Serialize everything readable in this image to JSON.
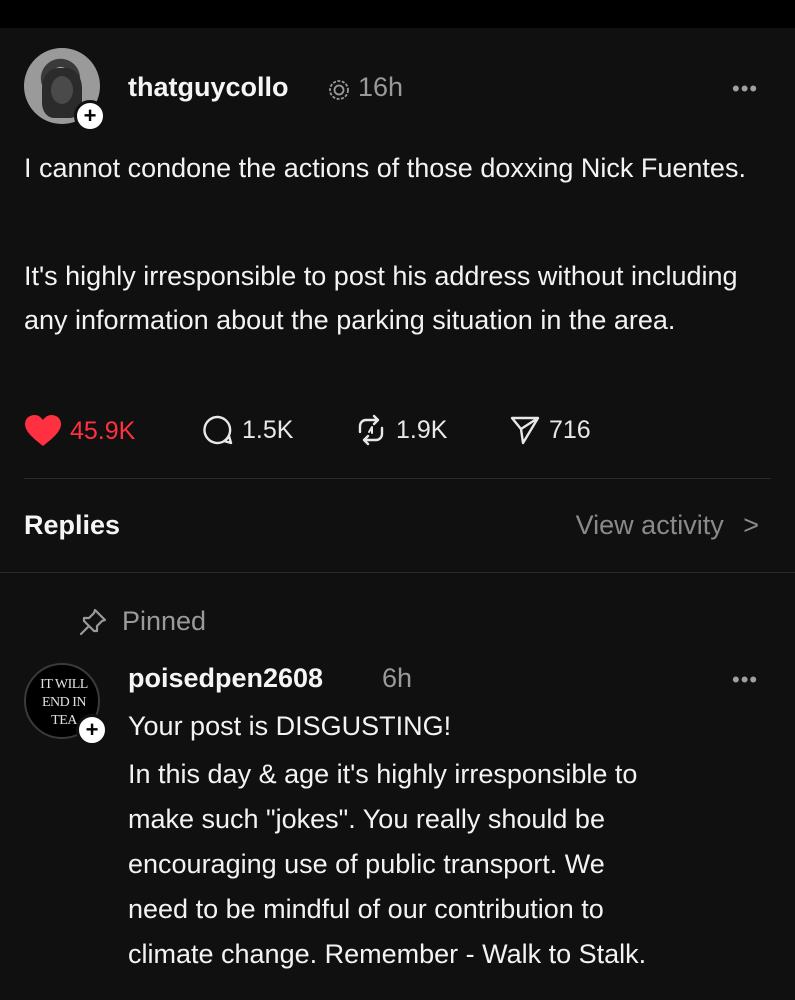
{
  "post": {
    "username": "thatguycollo",
    "time": "16h",
    "paragraphs": [
      "I cannot condone the actions of those doxxing Nick Fuentes.",
      "It's highly irresponsible to post his address without including any information about the parking situation in the area."
    ],
    "stats": {
      "likes": "45.9K",
      "comments": "1.5K",
      "reposts": "1.9K",
      "shares": "716"
    },
    "liked": true
  },
  "replies_header": {
    "title": "Replies",
    "view_activity": "View activity",
    "chevron": ">"
  },
  "pinned_label": "Pinned",
  "reply": {
    "username": "poisedpen2608",
    "time": "6h",
    "avatar_text": [
      "IT WILL",
      "END IN",
      "TEA"
    ],
    "lines": [
      "Your post is DISGUSTING!",
      "In this day & age it's highly irresponsible to",
      "make such \"jokes\". You really should be",
      "encouraging use of public transport. We",
      "need to be mindful of our contribution to",
      "climate change. Remember - Walk to Stalk."
    ]
  },
  "icons": {
    "plus": "+",
    "more": "•••"
  },
  "colors": {
    "background": "#101010",
    "like_red": "#ff3040",
    "muted": "#9a9a9a"
  }
}
